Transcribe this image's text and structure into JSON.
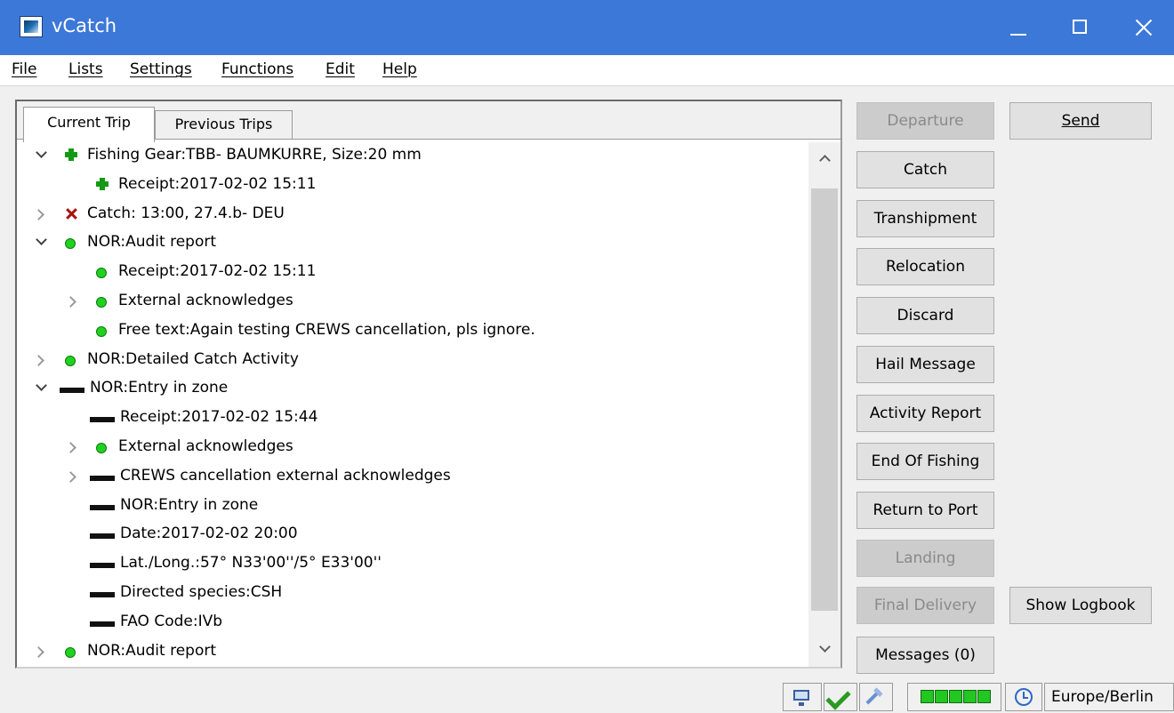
{
  "window": {
    "title": "vCatch"
  },
  "menu": [
    "File",
    "Lists",
    "Settings",
    "Functions",
    "Edit",
    "Help"
  ],
  "tabs": {
    "current": "Current Trip",
    "previous": "Previous Trips"
  },
  "tree": [
    {
      "text": "Fishing Gear:TBB- BAUMKURRE, Size:20 mm",
      "icon": "plus-icon",
      "expander": "open",
      "level": 0
    },
    {
      "text": "Receipt:2017-02-02 15:11",
      "icon": "plus-icon",
      "expander": "none",
      "level": 1
    },
    {
      "text": "Catch: 13:00, 27.4.b- DEU",
      "icon": "cross-icon",
      "expander": "closed",
      "level": 0
    },
    {
      "text": "NOR:Audit report",
      "icon": "green-dot-icon",
      "expander": "open",
      "level": 0
    },
    {
      "text": "Receipt:2017-02-02 15:11",
      "icon": "green-dot-icon",
      "expander": "none",
      "level": 1
    },
    {
      "text": "External acknowledges",
      "icon": "green-dot-icon",
      "expander": "closed",
      "level": 1
    },
    {
      "text": "Free text:Again testing CREWS cancellation, pls ignore.",
      "icon": "green-dot-icon",
      "expander": "none",
      "level": 1
    },
    {
      "text": "NOR:Detailed Catch Activity",
      "icon": "green-dot-icon",
      "expander": "closed",
      "level": 0
    },
    {
      "text": "NOR:Entry in zone",
      "icon": "dash-icon",
      "expander": "open",
      "level": 0
    },
    {
      "text": "Receipt:2017-02-02 15:44",
      "icon": "dash-icon",
      "expander": "none",
      "level": 1
    },
    {
      "text": "External acknowledges",
      "icon": "green-dot-icon",
      "expander": "closed",
      "level": 1
    },
    {
      "text": "CREWS cancellation external acknowledges",
      "icon": "dash-icon",
      "expander": "closed",
      "level": 1
    },
    {
      "text": "NOR:Entry in zone",
      "icon": "dash-icon",
      "expander": "none",
      "level": 1
    },
    {
      "text": "Date:2017-02-02 20:00",
      "icon": "dash-icon",
      "expander": "none",
      "level": 1
    },
    {
      "text": "Lat./Long.:57° N33'00''/5° E33'00''",
      "icon": "dash-icon",
      "expander": "none",
      "level": 1
    },
    {
      "text": "Directed species:CSH",
      "icon": "dash-icon",
      "expander": "none",
      "level": 1
    },
    {
      "text": "FAO Code:IVb",
      "icon": "dash-icon",
      "expander": "none",
      "level": 1
    },
    {
      "text": "NOR:Audit report",
      "icon": "green-dot-icon",
      "expander": "closed",
      "level": 0
    }
  ],
  "buttons": {
    "departure": "Departure",
    "catch": "Catch",
    "transhipment": "Transhipment",
    "relocation": "Relocation",
    "discard": "Discard",
    "hail_message": "Hail Message",
    "activity_report": "Activity Report",
    "end_of_fishing": "End Of Fishing",
    "return_to_port": "Return to Port",
    "landing": "Landing",
    "final_delivery": "Final Delivery",
    "messages": "Messages (0)",
    "send": "Send",
    "show_logbook": "Show Logbook"
  },
  "status": {
    "timezone": "Europe/Berlin",
    "signal_bars": 5
  },
  "colors": {
    "titlebar": "#3c78d8",
    "ok_green": "#1fd21f",
    "error_red": "#a8130f"
  }
}
